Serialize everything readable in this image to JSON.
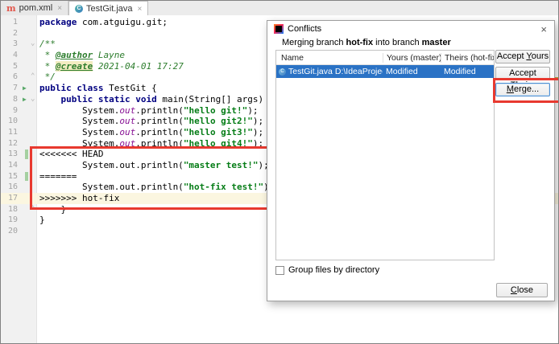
{
  "colors": {
    "annotation": "#e8392f",
    "selection": "#2a72c5",
    "keyword": "#000080",
    "string": "#067d17",
    "field": "#871094",
    "comment": "#2d7d2d"
  },
  "tabs": [
    {
      "label": "pom.xml",
      "icon": "maven-icon",
      "glyph": "m",
      "close": "×",
      "active": false
    },
    {
      "label": "TestGit.java",
      "icon": "java-class-icon",
      "glyph": "C",
      "close": "×",
      "active": true
    }
  ],
  "editor": {
    "run_icon_glyph": "▶",
    "lines": [
      {
        "n": "1",
        "seg": [
          [
            "k",
            "package"
          ],
          [
            "p",
            " com.atguigu.git;"
          ]
        ]
      },
      {
        "n": "2",
        "seg": []
      },
      {
        "n": "3",
        "seg": [
          [
            "c",
            "/**"
          ]
        ],
        "fold": "⌄"
      },
      {
        "n": "4",
        "seg": [
          [
            "c",
            " * "
          ],
          [
            "ct",
            "@author"
          ],
          [
            "c",
            " Layne"
          ]
        ]
      },
      {
        "n": "5",
        "seg": [
          [
            "c",
            " * "
          ],
          [
            "cth",
            "@create"
          ],
          [
            "c",
            " 2021-04-01 17:27"
          ]
        ]
      },
      {
        "n": "6",
        "seg": [
          [
            "c",
            " */"
          ]
        ],
        "fold": "⌃"
      },
      {
        "n": "7",
        "seg": [
          [
            "k",
            "public class"
          ],
          [
            "p",
            " TestGit {"
          ]
        ],
        "run": true
      },
      {
        "n": "8",
        "seg": [
          [
            "p",
            "    "
          ],
          [
            "k",
            "public static void"
          ],
          [
            "p",
            " main(String[] args) {"
          ]
        ],
        "run": true,
        "fold": "⌄"
      },
      {
        "n": "9",
        "seg": [
          [
            "p",
            "        System."
          ],
          [
            "f",
            "out"
          ],
          [
            "p",
            ".println("
          ],
          [
            "s",
            "\"hello git!\""
          ],
          [
            "p",
            ");"
          ]
        ]
      },
      {
        "n": "10",
        "seg": [
          [
            "p",
            "        System."
          ],
          [
            "f",
            "out"
          ],
          [
            "p",
            ".println("
          ],
          [
            "s",
            "\"hello git2!\""
          ],
          [
            "p",
            ");"
          ]
        ]
      },
      {
        "n": "11",
        "seg": [
          [
            "p",
            "        System."
          ],
          [
            "f",
            "out"
          ],
          [
            "p",
            ".println("
          ],
          [
            "s",
            "\"hello git3!\""
          ],
          [
            "p",
            ");"
          ]
        ]
      },
      {
        "n": "12",
        "seg": [
          [
            "p",
            "        System."
          ],
          [
            "f",
            "out"
          ],
          [
            "p",
            ".println("
          ],
          [
            "s",
            "\"hello git4!\""
          ],
          [
            "p",
            ");"
          ]
        ]
      },
      {
        "n": "13",
        "seg": [
          [
            "p",
            "<<<<<<< HEAD"
          ]
        ],
        "bar": true
      },
      {
        "n": "14",
        "seg": [
          [
            "p",
            "        System.out.println("
          ],
          [
            "s",
            "\"master test!\""
          ],
          [
            "p",
            ");"
          ]
        ]
      },
      {
        "n": "15",
        "seg": [
          [
            "p",
            "======="
          ]
        ],
        "bar": true
      },
      {
        "n": "16",
        "seg": [
          [
            "p",
            "        System.out.println("
          ],
          [
            "s",
            "\"hot-fix test!\""
          ],
          [
            "p",
            ");"
          ]
        ]
      },
      {
        "n": "17",
        "seg": [
          [
            "p",
            ">>>>>>> hot-fix"
          ]
        ],
        "caret": true
      },
      {
        "n": "18",
        "seg": [
          [
            "p",
            "    }"
          ]
        ],
        "fold": "⌃"
      },
      {
        "n": "19",
        "seg": [
          [
            "p",
            "}"
          ]
        ]
      },
      {
        "n": "20",
        "seg": []
      }
    ]
  },
  "dialog": {
    "title": "Conflicts",
    "close_icon": "×",
    "subtitle": {
      "part1": "Merging branch ",
      "branch1": "hot-fix",
      "part2": " into branch ",
      "branch2": "master"
    },
    "table": {
      "headers": {
        "name": "Name",
        "yours": "Yours (master)",
        "theirs": "Theirs (hot-fix)"
      },
      "row": {
        "icon_glyph": "C",
        "file": "TestGit.java",
        "path": "D:\\IdeaProjects\\git-te",
        "yours": "Modified",
        "theirs": "Modified"
      }
    },
    "buttons": {
      "accept_yours": {
        "pre": "Accept ",
        "key": "Y",
        "post": "ours"
      },
      "accept_theirs": {
        "pre": "Accept ",
        "key": "T",
        "post": "heirs"
      },
      "merge": {
        "pre": "",
        "key": "M",
        "post": "erge..."
      },
      "close": {
        "pre": "",
        "key": "C",
        "post": "lose"
      }
    },
    "checkbox_label": "Group files by directory"
  }
}
